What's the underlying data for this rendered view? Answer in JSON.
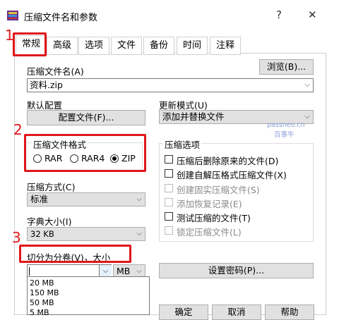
{
  "window": {
    "title": "压缩文件名和参数",
    "help_label": "?",
    "close_label": "✕"
  },
  "tabs": [
    "常规",
    "高级",
    "选项",
    "文件",
    "备份",
    "时间",
    "注释"
  ],
  "archive_name": {
    "label": "压缩文件名(A)",
    "value": "资料.zip",
    "browse_label": "浏览(B)..."
  },
  "default_config": {
    "label": "默认配置",
    "button_label": "配置文件(F)..."
  },
  "update_mode": {
    "label": "更新模式(U)",
    "value": "添加并替换文件"
  },
  "format": {
    "label": "压缩文件格式",
    "options": [
      "RAR",
      "RAR4",
      "ZIP"
    ],
    "selected": "ZIP"
  },
  "method": {
    "label": "压缩方式(C)",
    "value": "标准"
  },
  "dict_size": {
    "label": "字典大小(I)",
    "value": "32 KB"
  },
  "split": {
    "label": "切分为分卷(V)，大小",
    "value": "",
    "unit": "MB",
    "options": [
      "20 MB",
      "150 MB",
      "50 MB",
      "5 MB"
    ]
  },
  "password_button": "设置密码(P)...",
  "options": {
    "title": "压缩选项",
    "items": [
      {
        "label": "压缩后删除原来的文件(D)",
        "enabled": true,
        "checked": false
      },
      {
        "label": "创建自解压格式压缩文件(X)",
        "enabled": true,
        "checked": false
      },
      {
        "label": "创建固实压缩文件(S)",
        "enabled": false,
        "checked": false
      },
      {
        "label": "添加恢复记录(E)",
        "enabled": false,
        "checked": false
      },
      {
        "label": "测试压缩的文件(T)",
        "enabled": true,
        "checked": false
      },
      {
        "label": "锁定压缩文件(L)",
        "enabled": false,
        "checked": false
      }
    ]
  },
  "annotations": {
    "n1": "1",
    "n2": "2",
    "n3": "3"
  },
  "watermark": {
    "line1": "passneo.cn",
    "line2": "百事牛"
  },
  "bottom_buttons": [
    "确定",
    "取消",
    "帮助"
  ],
  "colors": {
    "annotation_red": "#e0161a",
    "button_bg": "#e1e1e1"
  }
}
